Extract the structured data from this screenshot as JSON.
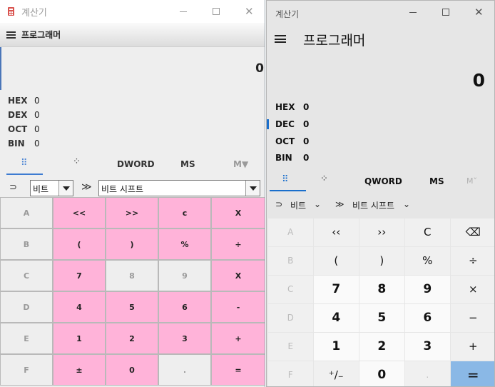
{
  "left_window": {
    "title": "계산기",
    "mode": "프로그래머",
    "result": "0",
    "radix": [
      {
        "label": "HEX",
        "value": "0"
      },
      {
        "label": "DEX",
        "value": "0"
      },
      {
        "label": "OCT",
        "value": "0"
      },
      {
        "label": "BIN",
        "value": "0"
      }
    ],
    "tabs": {
      "keypad": "⠿",
      "bits": "⁘",
      "word": "DWORD",
      "ms": "MS",
      "mv": "M▼"
    },
    "selectors": {
      "bitwise": "비트",
      "shift": "비트 시프트"
    },
    "keys": [
      [
        "A",
        "<<",
        ">>",
        "c",
        "X"
      ],
      [
        "B",
        "(",
        ")",
        "%",
        "÷"
      ],
      [
        "C",
        "7",
        "8",
        "9",
        "X"
      ],
      [
        "D",
        "4",
        "5",
        "6",
        "-"
      ],
      [
        "E",
        "1",
        "2",
        "3",
        "+"
      ],
      [
        "F",
        "±",
        "0",
        ".",
        "="
      ]
    ],
    "colors": {
      "key_active": "#ffb3d9",
      "key_disabled": "#eeeeee",
      "accent": "#3d7bd1"
    }
  },
  "right_window": {
    "title": "계산기",
    "mode": "프로그래머",
    "result": "0",
    "radix": [
      {
        "label": "HEX",
        "value": "0"
      },
      {
        "label": "DEC",
        "value": "0"
      },
      {
        "label": "OCT",
        "value": "0"
      },
      {
        "label": "BIN",
        "value": "0"
      }
    ],
    "tabs": {
      "keypad": "⠿",
      "bits": "⁘",
      "word": "QWORD",
      "ms": "MS",
      "mv": "M˅"
    },
    "selectors": {
      "bitwise": "비트",
      "shift": "비트 시프트"
    },
    "keys": [
      [
        "A",
        "‹‹",
        "››",
        "C",
        "⌫"
      ],
      [
        "B",
        "(",
        ")",
        "%",
        "÷"
      ],
      [
        "C",
        "7",
        "8",
        "9",
        "×"
      ],
      [
        "D",
        "4",
        "5",
        "6",
        "−"
      ],
      [
        "E",
        "1",
        "2",
        "3",
        "+"
      ],
      [
        "F",
        "⁺/₋",
        "0",
        ".",
        "="
      ]
    ],
    "colors": {
      "accent": "#1a6fcc",
      "equals": "#8ab8e6"
    }
  }
}
